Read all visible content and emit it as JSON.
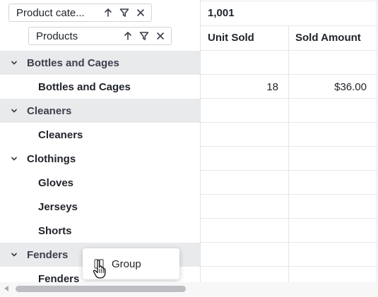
{
  "header": {
    "category_chip": {
      "label": "Product cate..."
    },
    "products_chip": {
      "label": "Products"
    },
    "grand_total": "1,001",
    "columns": [
      "Unit Sold",
      "Sold Amount"
    ]
  },
  "rows": [
    {
      "type": "group",
      "label": "Bottles and Cages",
      "unit_sold": "",
      "sold_amount": ""
    },
    {
      "type": "child",
      "label": "Bottles and Cages",
      "unit_sold": "18",
      "sold_amount": "$36.00"
    },
    {
      "type": "group",
      "label": "Cleaners",
      "unit_sold": "",
      "sold_amount": ""
    },
    {
      "type": "child",
      "label": "Cleaners",
      "unit_sold": "",
      "sold_amount": ""
    },
    {
      "type": "group-light",
      "label": "Clothings",
      "unit_sold": "",
      "sold_amount": ""
    },
    {
      "type": "child",
      "label": "Gloves",
      "unit_sold": "",
      "sold_amount": ""
    },
    {
      "type": "child",
      "label": "Jerseys",
      "unit_sold": "",
      "sold_amount": ""
    },
    {
      "type": "child",
      "label": "Shorts",
      "unit_sold": "",
      "sold_amount": ""
    },
    {
      "type": "group",
      "label": "Fenders",
      "unit_sold": "",
      "sold_amount": ""
    },
    {
      "type": "child",
      "label": "Fenders",
      "unit_sold": "",
      "sold_amount": ""
    }
  ],
  "popup": {
    "label": "Group",
    "icon": "group-icon"
  },
  "icons": {
    "sort": "arrow-up-icon",
    "filter": "filter-icon",
    "remove": "close-icon",
    "expand": "chevron-down-icon"
  },
  "colors": {
    "group_row_bg": "#e9eaec",
    "grid_line": "#e2e4e8",
    "text": "#1f2329"
  }
}
